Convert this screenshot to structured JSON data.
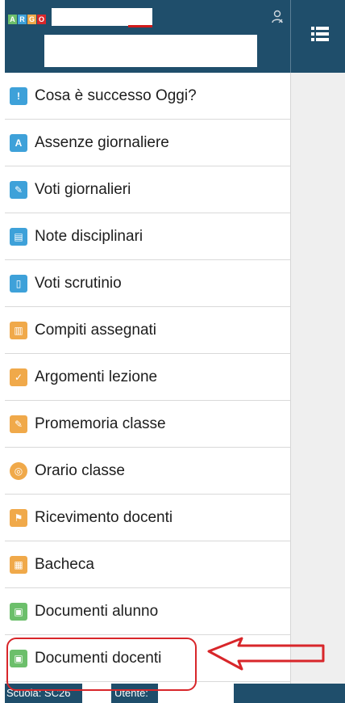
{
  "header": {
    "logo_letters": [
      "A",
      "R",
      "G",
      "O"
    ],
    "logo_colors": [
      "#6cbf6b",
      "#3ea1d9",
      "#f0a94a",
      "#d8262a"
    ]
  },
  "menu": [
    {
      "label": "Cosa è successo Oggi?",
      "icon": "info-icon",
      "color": "blue"
    },
    {
      "label": "Assenze giornaliere",
      "icon": "absence-icon",
      "color": "blue"
    },
    {
      "label": "Voti giornalieri",
      "icon": "grades-icon",
      "color": "blue"
    },
    {
      "label": "Note disciplinari",
      "icon": "notes-icon",
      "color": "blue"
    },
    {
      "label": "Voti scrutinio",
      "icon": "report-card-icon",
      "color": "blue"
    },
    {
      "label": "Compiti assegnati",
      "icon": "homework-icon",
      "color": "orange"
    },
    {
      "label": "Argomenti lezione",
      "icon": "lesson-topics-icon",
      "color": "orange"
    },
    {
      "label": "Promemoria classe",
      "icon": "reminder-icon",
      "color": "orange"
    },
    {
      "label": "Orario classe",
      "icon": "timetable-icon",
      "color": "orange"
    },
    {
      "label": "Ricevimento docenti",
      "icon": "teacher-meeting-icon",
      "color": "orange"
    },
    {
      "label": "Bacheca",
      "icon": "noticeboard-icon",
      "color": "orange"
    },
    {
      "label": "Documenti alunno",
      "icon": "student-documents-icon",
      "color": "green"
    },
    {
      "label": "Documenti docenti",
      "icon": "teacher-documents-icon",
      "color": "green"
    }
  ],
  "footer": {
    "school_label": "Scuola: SC26",
    "user_label": "Utente:"
  },
  "colors": {
    "header_bg": "#1f4e6b",
    "annotation": "#d8262a"
  }
}
